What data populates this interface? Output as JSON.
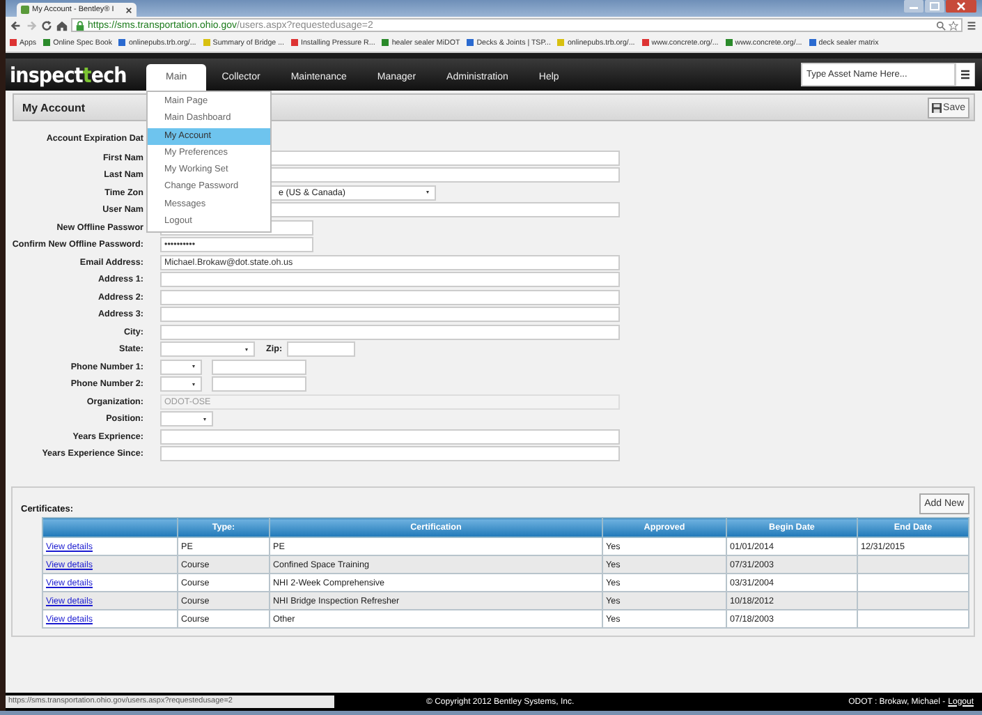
{
  "browser": {
    "tab_title": "My Account - Bentley® I",
    "url_host": "https://sms.transportation.ohio.gov",
    "url_path": "/users.aspx?requestedusage=2",
    "bookmarks": [
      "Apps",
      "Online Spec Book",
      "onlinepubs.trb.org/...",
      "Summary of Bridge ...",
      "Installing Pressure R...",
      "healer sealer MiDOT",
      "Decks & Joints | TSP...",
      "onlinepubs.trb.org/...",
      "www.concrete.org/...",
      "www.concrete.org/...",
      "deck sealer matrix"
    ]
  },
  "logo": [
    "inspect",
    "t",
    "ech"
  ],
  "nav": [
    {
      "label": "Main",
      "selected": true
    },
    {
      "label": "Collector",
      "selected": false
    },
    {
      "label": "Maintenance",
      "selected": false
    },
    {
      "label": "Manager",
      "selected": false
    },
    {
      "label": "Administration",
      "selected": false
    },
    {
      "label": "Help",
      "selected": false
    }
  ],
  "asset_search": {
    "placeholder": "Type Asset Name Here..."
  },
  "menu": [
    {
      "label": "Main Page",
      "selected": false
    },
    {
      "label": "Main Dashboard",
      "selected": false
    },
    {
      "label": "My Account",
      "selected": true
    },
    {
      "label": "My Preferences",
      "selected": false
    },
    {
      "label": "My Working Set",
      "selected": false
    },
    {
      "label": "Change Password",
      "selected": false
    },
    {
      "label": "Messages",
      "selected": false
    },
    {
      "label": "Logout",
      "selected": false
    }
  ],
  "page_title": "My Account",
  "save_button": "Save",
  "fields": [
    {
      "label": "Account Expiration Dat",
      "kind": "plain"
    },
    {
      "label": "First Nam",
      "kind": "text"
    },
    {
      "label": "Last Nam",
      "kind": "text"
    },
    {
      "label": "Time Zon",
      "kind": "timezone",
      "value": "e (US & Canada)"
    },
    {
      "label": "User Nam",
      "kind": "text"
    },
    {
      "label": "New Offline Passwor",
      "kind": "short"
    },
    {
      "label": "Confirm New Offline Password:",
      "kind": "short",
      "value": "••••••••••"
    },
    {
      "label": "Email Address:",
      "kind": "text",
      "value": "Michael.Brokaw@dot.state.oh.us",
      "disabled": false
    },
    {
      "label": "Address 1:",
      "kind": "text"
    },
    {
      "label": "Address 2:",
      "kind": "text"
    },
    {
      "label": "Address 3:",
      "kind": "text"
    },
    {
      "label": "City:",
      "kind": "text"
    },
    {
      "label": "State:",
      "kind": "state",
      "zip_label": "Zip:"
    },
    {
      "label": "Phone Number 1:",
      "kind": "phone"
    },
    {
      "label": "Phone Number 2:",
      "kind": "phone"
    },
    {
      "label": "Organization:",
      "kind": "text",
      "value": "ODOT-OSE",
      "disabled": true
    },
    {
      "label": "Position:",
      "kind": "position"
    },
    {
      "label": "Years Exprience:",
      "kind": "text"
    },
    {
      "label": "Years Experience Since:",
      "kind": "text"
    }
  ],
  "certificates": {
    "title": "Certificates:",
    "add_button": "Add New",
    "columns": [
      "Type:",
      "Certification",
      "Approved",
      "Begin Date",
      "End Date"
    ],
    "rows": [
      {
        "link": "View details",
        "type": "PE",
        "certification": "PE",
        "approved": "Yes",
        "begin": "01/01/2014",
        "end": "12/31/2015"
      },
      {
        "link": "View details",
        "type": "Course",
        "certification": "Confined Space Training",
        "approved": "Yes",
        "begin": "07/31/2003"
      },
      {
        "link": "View details",
        "type": "Course",
        "certification": "NHI 2-Week Comprehensive",
        "approved": "Yes",
        "begin": "03/31/2004"
      },
      {
        "link": "View details",
        "type": "Course",
        "certification": "NHI Bridge Inspection Refresher",
        "approved": "Yes",
        "begin": "10/18/2012"
      },
      {
        "link": "View details",
        "type": "Course",
        "certification": "Other",
        "approved": "Yes",
        "begin": "07/18/2003"
      }
    ]
  },
  "status_url": "https://sms.transportation.ohio.gov/users.aspx?requestedusage=2",
  "footer": {
    "copyright": "© Copyright 2012 Bentley Systems, Inc.",
    "user": "ODOT : Brokaw, Michael -",
    "logout": "Logout"
  }
}
